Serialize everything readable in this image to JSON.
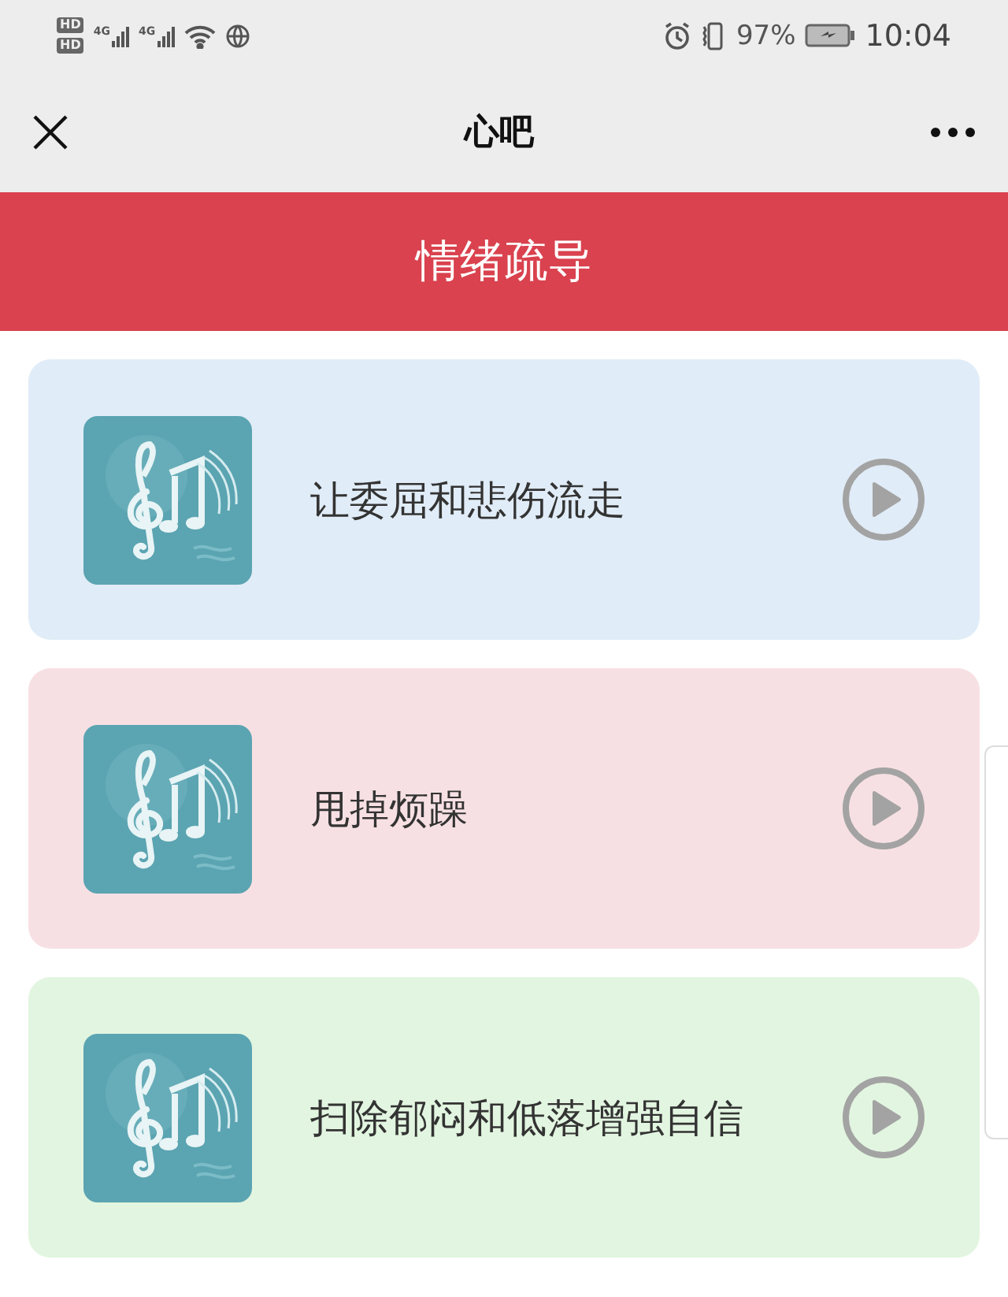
{
  "status_bar": {
    "sim_labels": [
      "HD",
      "HD"
    ],
    "network_labels": [
      "4G",
      "4G"
    ],
    "battery": "97%",
    "time": "10:04"
  },
  "nav": {
    "title": "心吧"
  },
  "banner": {
    "title": "情绪疏导"
  },
  "tracks": [
    {
      "title": "让委屈和悲伤流走",
      "color": "#e0ecf7"
    },
    {
      "title": "甩掉烦躁",
      "color": "#f7e0e3"
    },
    {
      "title": "扫除郁闷和低落增强自信",
      "color": "#e2f5e0"
    }
  ]
}
